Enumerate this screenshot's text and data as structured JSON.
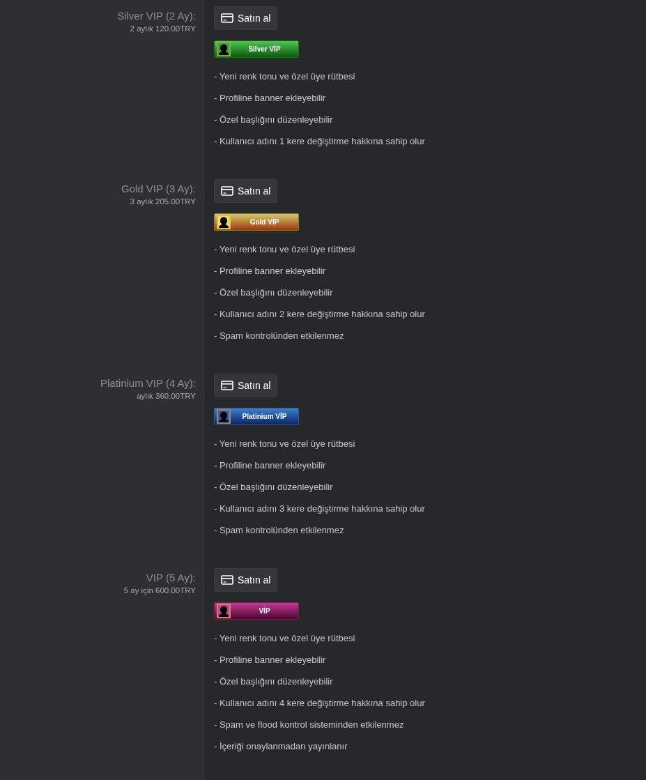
{
  "plans": [
    {
      "title": "Silver VIP (2 Ay):",
      "price": "2 aylık 120.00TRY",
      "button": "Satın al",
      "badge": {
        "kind": "silver",
        "label": "Silver VİP"
      },
      "features": [
        "- Yeni renk tonu ve özel üye rütbesi",
        "- Profiline banner ekleyebilir",
        "- Özel başlığını düzenleyebilir",
        "- Kullanıcı adını 1 kere değiştirme hakkına sahip olur"
      ]
    },
    {
      "title": "Gold VIP (3 Ay):",
      "price": "3 aylık 205.00TRY",
      "button": "Satın al",
      "badge": {
        "kind": "gold",
        "label": "Gold VİP"
      },
      "features": [
        "- Yeni renk tonu ve özel üye rütbesi",
        "- Profiline banner ekleyebilir",
        "- Özel başlığını düzenleyebilir",
        "- Kullanıcı adını 2 kere değiştirme hakkına sahip olur",
        "- Spam kontrolünden etkilenmez"
      ]
    },
    {
      "title": "Platinium VIP (4 Ay):",
      "price": "aylık 360.00TRY",
      "button": "Satın al",
      "badge": {
        "kind": "platinium",
        "label": "Platinium VİP"
      },
      "features": [
        "- Yeni renk tonu ve özel üye rütbesi",
        "- Profiline banner ekleyebilir",
        "- Özel başlığını düzenleyebilir",
        "- Kullanıcı adını 3 kere değiştirme hakkına sahip olur",
        "- Spam kontrolünden etkilenmez"
      ]
    },
    {
      "title": "VIP (5 Ay):",
      "price": "5 ay için 600.00TRY",
      "button": "Satın al",
      "badge": {
        "kind": "vip",
        "label": "VİP"
      },
      "features": [
        "- Yeni renk tonu ve özel üye rütbesi",
        "- Profiline banner ekleyebilir",
        "- Özel başlığını düzenleyebilir",
        "- Kullanıcı adını 4 kere değiştirme hakkına sahip olur",
        "- Spam ve flood kontrol sisteminden etkilenmez",
        "- İçeriği onaylanmadan yayınlanır"
      ]
    }
  ]
}
